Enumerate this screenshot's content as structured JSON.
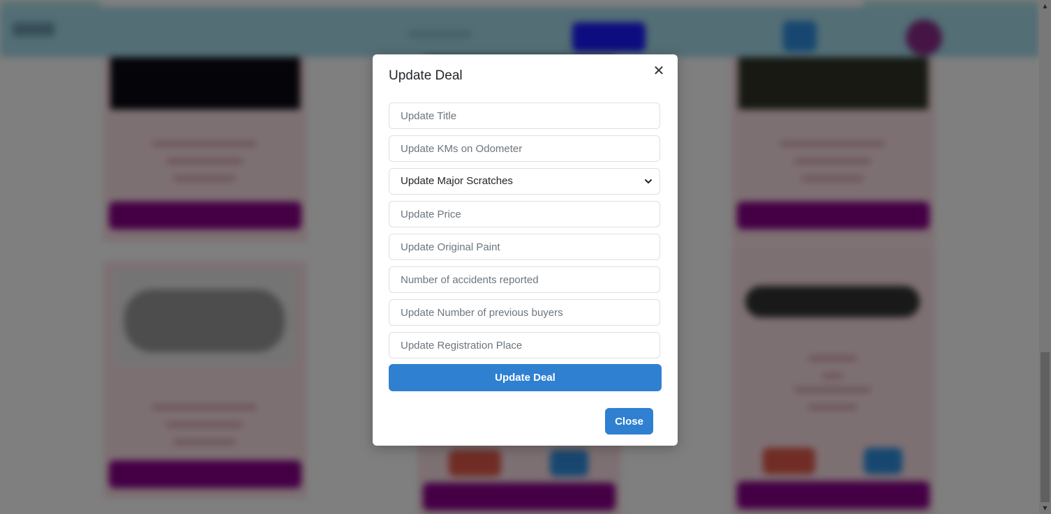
{
  "modal": {
    "title": "Update Deal",
    "close_icon": "close-icon",
    "fields": {
      "title_placeholder": "Update Title",
      "kms_placeholder": "Update KMs on Odometer",
      "scratches_selected": "Update Major Scratches",
      "price_placeholder": "Update Price",
      "paint_placeholder": "Update Original Paint",
      "accidents_placeholder": "Number of accidents reported",
      "buyers_placeholder": "Update Number of previous buyers",
      "registration_placeholder": "Update Registration Place"
    },
    "submit_label": "Update Deal",
    "close_label": "Close"
  },
  "colors": {
    "primary": "#2f80d1",
    "card_bg": "#fbe0e6",
    "card_button": "#8a008a",
    "navbar": "#a6dceb"
  }
}
